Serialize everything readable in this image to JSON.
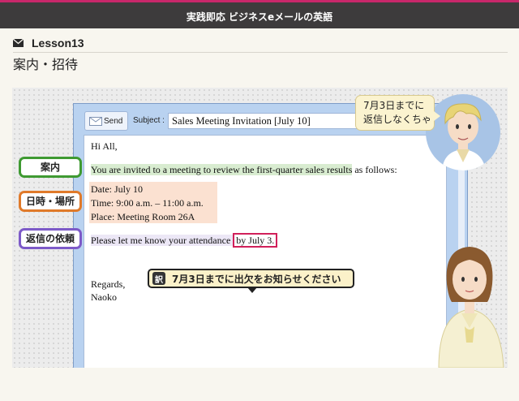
{
  "app_title": "実践即応 ビジネスeメールの英語",
  "lesson": {
    "icon": "mail-icon",
    "label": "Lesson13"
  },
  "subtitle": "案内・招待",
  "mail": {
    "send_label": "Send",
    "subject_label": "Subject :",
    "subject_value": "Sales Meeting Invitation [July 10]",
    "greeting": "Hi All,",
    "line_invite_hl": "You are invited to a meeting to review the first-quarter sales results",
    "line_invite_rest": " as follows:",
    "date": "Date:   July 10",
    "time": "Time:   9:00 a.m. – 11:00 a.m.",
    "place": "Place:  Meeting Room 26A",
    "reply_hl": "Please let me know your attendance ",
    "reply_boxed": "by July 3.",
    "closing": "Regards,",
    "signature": "Naoko"
  },
  "tags": {
    "announcement": "案内",
    "datetime_place": "日時・場所",
    "reply_request": "返信の依頼"
  },
  "translation": {
    "badge": "訳",
    "text": "7月3日までに出欠をお知らせください"
  },
  "speech_bubble": {
    "line1": "7月3日までに",
    "line2": "返信しなくちゃ"
  },
  "colors": {
    "topbar_bg": "#3d3b3c",
    "topbar_accent": "#c8276a",
    "green": "#3f9a32",
    "orange": "#e07a2a",
    "purple": "#7d5ac8",
    "red_box": "#d1205a"
  }
}
